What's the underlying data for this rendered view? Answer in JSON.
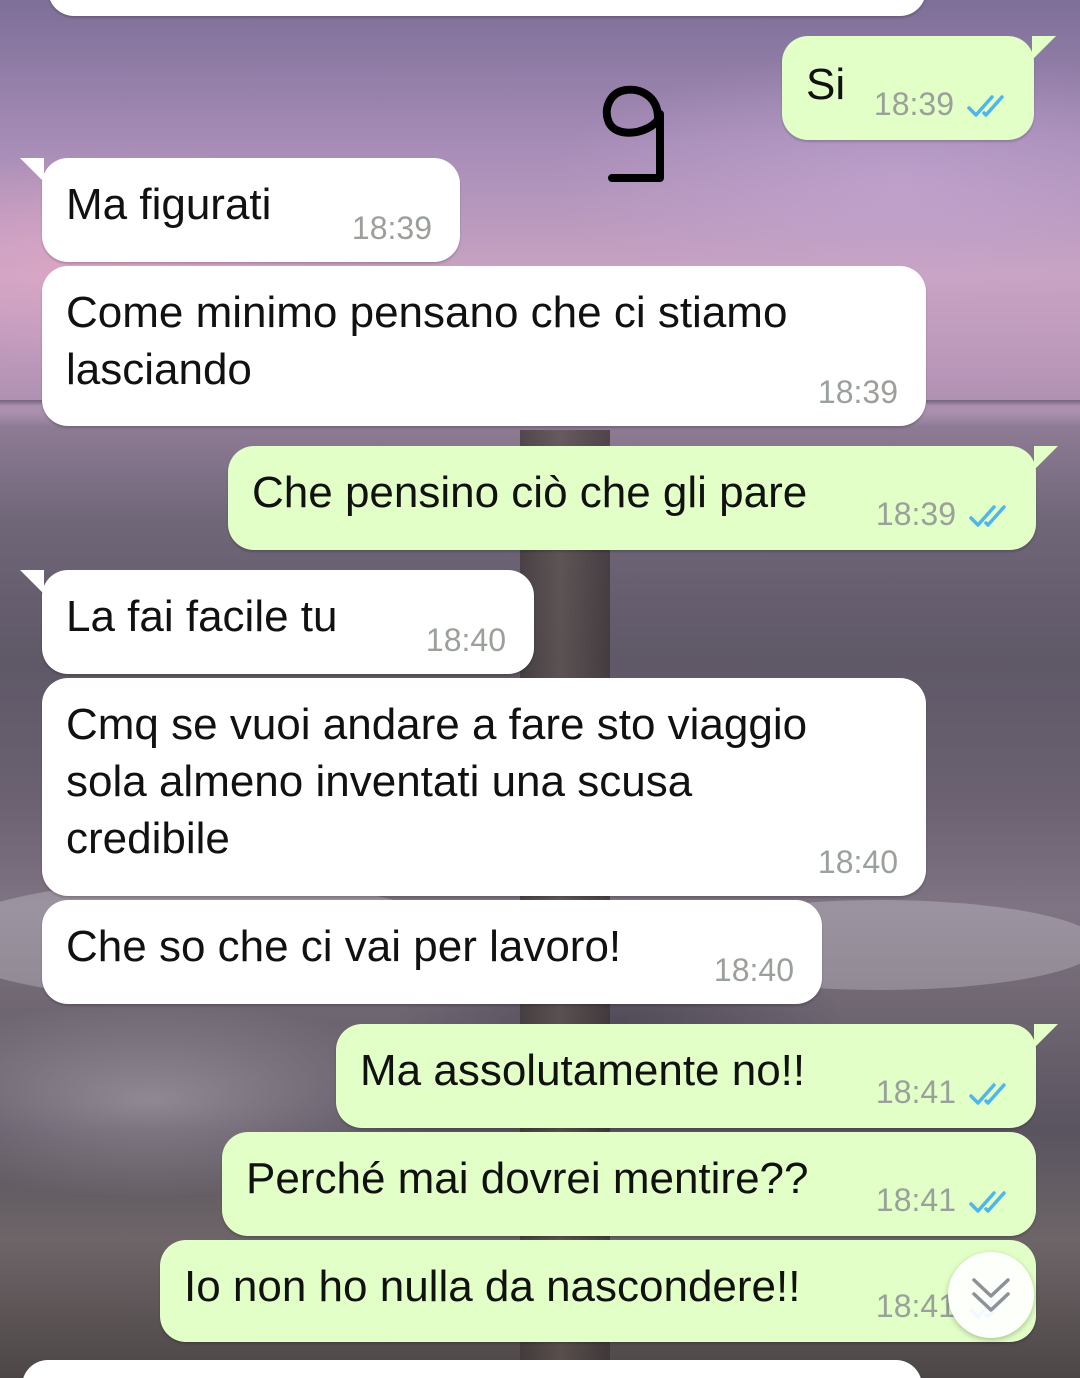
{
  "handwritten_mark": "9",
  "messages": [
    {
      "direction": "out",
      "text": "Si",
      "time": "18:39",
      "status": "read"
    },
    {
      "direction": "in",
      "text": "Ma figurati",
      "time": "18:39"
    },
    {
      "direction": "in",
      "text": "Come minimo pensano che ci stiamo\nlasciando",
      "time": "18:39"
    },
    {
      "direction": "out",
      "text": "Che pensino ciò che gli pare",
      "time": "18:39",
      "status": "read"
    },
    {
      "direction": "in",
      "text": "La fai facile tu",
      "time": "18:40"
    },
    {
      "direction": "in",
      "text": "Cmq se vuoi andare a fare sto viaggio\nsola almeno inventati una scusa\ncredibile",
      "time": "18:40"
    },
    {
      "direction": "in",
      "text": "Che so che ci vai per lavoro!",
      "time": "18:40"
    },
    {
      "direction": "out",
      "text": "Ma assolutamente no!!",
      "time": "18:41",
      "status": "read"
    },
    {
      "direction": "out",
      "text": "Perché mai dovrei mentire??",
      "time": "18:41",
      "status": "read"
    },
    {
      "direction": "out",
      "text": "Io non ho nulla da nascondere!!",
      "time": "18:41",
      "status": "read"
    }
  ],
  "colors": {
    "incoming_bubble": "#ffffff",
    "outgoing_bubble": "#e2ffc7",
    "read_ticks": "#4fb6ec",
    "timestamp": "#9aa09a"
  },
  "icons": {
    "read_status": "double-check-icon",
    "scroll_to_bottom": "chevron-double-down-icon"
  }
}
